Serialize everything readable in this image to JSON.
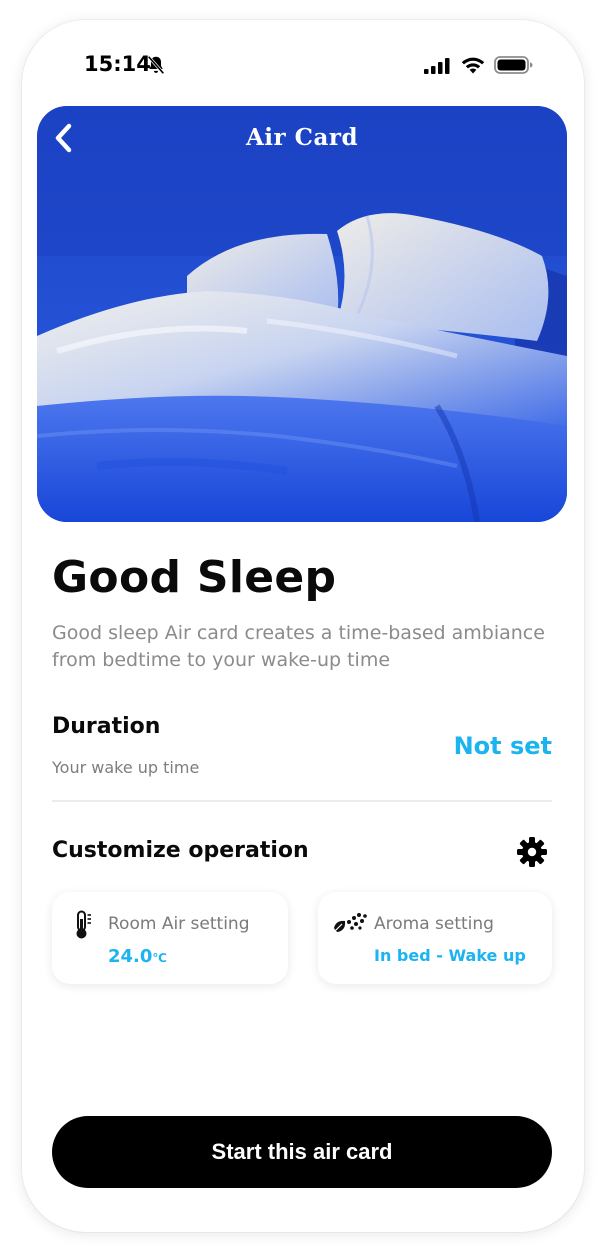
{
  "status_bar": {
    "time": "15:14"
  },
  "header": {
    "title": "Air Card"
  },
  "card": {
    "title": "Good Sleep",
    "description": "Good sleep Air card creates a time-based ambiance from bedtime to your wake-up time"
  },
  "duration": {
    "label": "Duration",
    "sublabel": "Your wake up time",
    "value": "Not set"
  },
  "customize": {
    "label": "Customize operation"
  },
  "settings": {
    "room_air": {
      "label": "Room Air setting",
      "value": "24.0",
      "unit": "℃"
    },
    "aroma": {
      "label": "Aroma setting",
      "value": "In bed - Wake up"
    }
  },
  "actions": {
    "start_label": "Start this air card"
  },
  "colors": {
    "accent": "#1bb3f0",
    "button": "#000000",
    "hero_blue": "#1a4fd6"
  }
}
